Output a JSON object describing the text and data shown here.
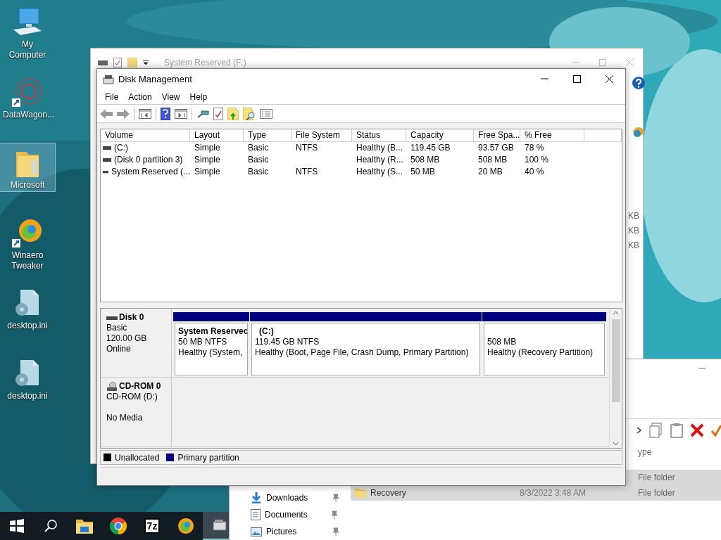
{
  "desktop_icons": [
    {
      "label": "My Computer",
      "kind": "computer",
      "selected": false
    },
    {
      "label": "DataWagon...",
      "kind": "shortcut-app",
      "selected": false
    },
    {
      "label": "Microsoft",
      "kind": "folder",
      "selected": true
    },
    {
      "label": "Winaero Tweaker",
      "kind": "shortcut-tweaker",
      "selected": false
    },
    {
      "label": "desktop.ini",
      "kind": "settings-file",
      "selected": false
    },
    {
      "label": "desktop.ini",
      "kind": "settings-file",
      "selected": false
    }
  ],
  "taskbar": {
    "apps": [
      {
        "kind": "start"
      },
      {
        "kind": "search"
      },
      {
        "kind": "explorer"
      },
      {
        "kind": "chrome"
      },
      {
        "kind": "archiver",
        "label": "7z"
      },
      {
        "kind": "tweaker"
      },
      {
        "kind": "disk"
      }
    ]
  },
  "background_window": {
    "title": "System Reserved (F:)",
    "side_texts": [
      "KB",
      "KB",
      "KB"
    ]
  },
  "explorer_window": {
    "nav_items": [
      {
        "label": "Downloads",
        "kind": "downloads",
        "pinned": true
      },
      {
        "label": "Documents",
        "kind": "documents",
        "pinned": true
      },
      {
        "label": "Pictures",
        "kind": "pictures",
        "pinned": true
      }
    ],
    "column_header": "ype",
    "rows": [
      {
        "type": "File folder",
        "selected": true
      },
      {
        "name": "Recovery",
        "date": "8/3/2022 3:48 AM",
        "type": "File folder",
        "selected": true
      }
    ]
  },
  "disk_management": {
    "title": "Disk Management",
    "menu": [
      "File",
      "Action",
      "View",
      "Help"
    ],
    "toolbar": [
      {
        "kind": "back"
      },
      {
        "kind": "forward"
      },
      {
        "kind": "separator"
      },
      {
        "kind": "console-tree"
      },
      {
        "kind": "separator"
      },
      {
        "kind": "help"
      },
      {
        "kind": "action-pane"
      },
      {
        "kind": "separator"
      },
      {
        "kind": "connect"
      },
      {
        "kind": "properties"
      },
      {
        "kind": "folder-up"
      },
      {
        "kind": "folder-search"
      },
      {
        "kind": "list"
      }
    ],
    "volumes": {
      "columns": [
        "Volume",
        "Layout",
        "Type",
        "File System",
        "Status",
        "Capacity",
        "Free Spa...",
        "% Free"
      ],
      "rows": [
        [
          " (C:)",
          "Simple",
          "Basic",
          "NTFS",
          "Healthy (B...",
          "119.45 GB",
          "93.57 GB",
          "78 %"
        ],
        [
          "(Disk 0 partition 3)",
          "Simple",
          "Basic",
          null,
          "Healthy (R...",
          "508 MB",
          "508 MB",
          "100 %"
        ],
        [
          "System Reserved (...",
          "Simple",
          "Basic",
          "NTFS",
          "Healthy (S...",
          "50 MB",
          "20 MB",
          "40 %"
        ]
      ]
    },
    "disks": [
      {
        "name": "Disk 0",
        "kind": "disk",
        "type": "Basic",
        "size": "120.00 GB",
        "state": "Online",
        "partitions": [
          {
            "label": "System Reservec",
            "size": "50 MB NTFS",
            "status": "Healthy (System, ",
            "kind": "primary"
          },
          {
            "label": "(C:)",
            "size": "119.45 GB NTFS",
            "status": "Healthy (Boot, Page File, Crash Dump, Primary Partition)",
            "kind": "primary"
          },
          {
            "size": "508 MB",
            "status": "Healthy (Recovery Partition)",
            "kind": "primary"
          }
        ]
      },
      {
        "name": "CD-ROM 0",
        "kind": "cdrom",
        "type": "CD-ROM (D:)",
        "state": "No Media"
      }
    ],
    "legend": [
      {
        "label": "Unallocated",
        "color": "#000000"
      },
      {
        "label": "Primary partition",
        "color": "#000080"
      }
    ]
  }
}
